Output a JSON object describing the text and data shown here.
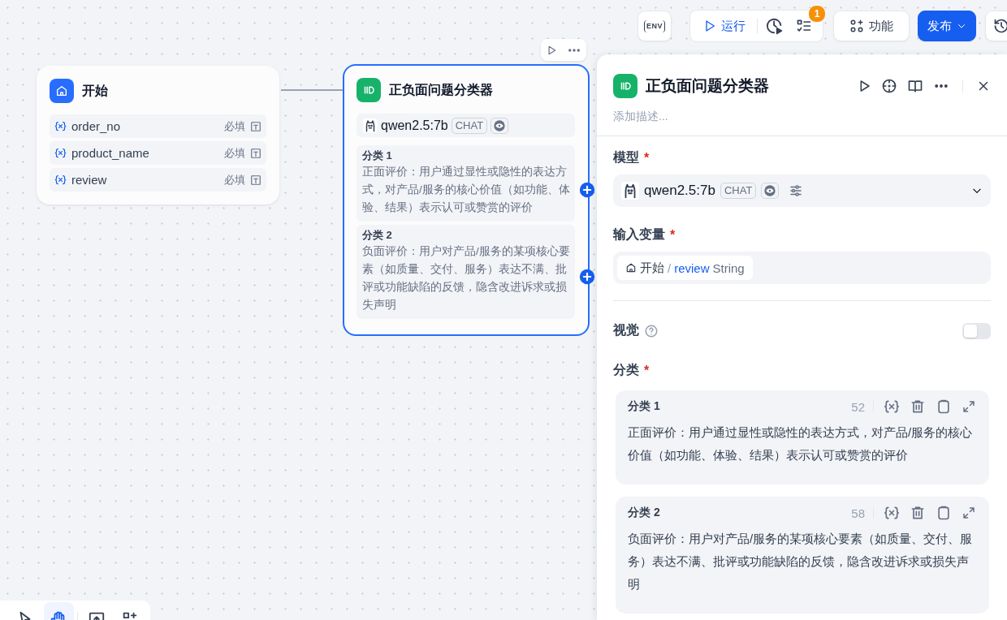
{
  "toolbar": {
    "env_label": "ENV",
    "run_label": "运行",
    "checklist_badge": "1",
    "features_label": "功能",
    "publish_label": "发布"
  },
  "start_node": {
    "title": "开始",
    "variables": [
      {
        "name": "order_no",
        "required_label": "必填"
      },
      {
        "name": "product_name",
        "required_label": "必填"
      },
      {
        "name": "review",
        "required_label": "必填"
      }
    ]
  },
  "classifier_node": {
    "title": "正负面问题分类器",
    "model": {
      "name": "qwen2.5:7b",
      "mode_tag": "CHAT"
    },
    "classes": [
      {
        "label": "分类 1",
        "text": "正面评价：用户通过显性或隐性的表达方式，对产品/服务的核心价值（如功能、体验、结果）表示认可或赞赏的评价"
      },
      {
        "label": "分类 2",
        "text": "负面评价：用户对产品/服务的某项核心要素（如质量、交付、服务）表达不满、批评或功能缺陷的反馈，隐含改进诉求或损失声明"
      }
    ]
  },
  "panel": {
    "title": "正负面问题分类器",
    "description_placeholder": "添加描述...",
    "model_label": "模型",
    "model_required_mark": "*",
    "model": {
      "name": "qwen2.5:7b",
      "mode_tag": "CHAT"
    },
    "input_label": "输入变量",
    "input_required_mark": "*",
    "input_variable": {
      "node": "开始",
      "separator": "/",
      "name": "review",
      "type": "String"
    },
    "vision": {
      "label": "视觉",
      "on": false
    },
    "classes_label": "分类",
    "classes_required_mark": "*",
    "classes": [
      {
        "label": "分类 1",
        "count": "52",
        "text": "正面评价：用户通过显性或隐性的表达方式，对产品/服务的核心价值（如功能、体验、结果）表示认可或赞赏的评价"
      },
      {
        "label": "分类 2",
        "count": "58",
        "text": "负面评价：用户对产品/服务的某项核心要素（如质量、交付、服务）表达不满、批评或功能缺陷的反馈，隐含改进诉求或损失声明"
      }
    ]
  },
  "canvas_tools": [
    {
      "kind": "pointer",
      "selected": false
    },
    {
      "kind": "hand",
      "selected": true
    },
    {
      "kind": "import",
      "selected": false
    },
    {
      "kind": "organize",
      "selected": false
    }
  ]
}
